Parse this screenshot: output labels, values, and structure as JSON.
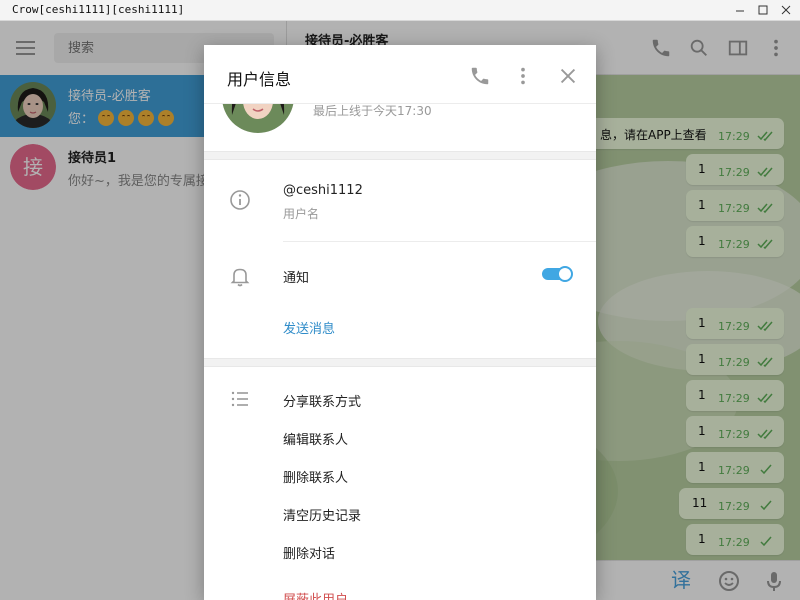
{
  "window": {
    "title": "Crow[ceshi1111][ceshi1111]"
  },
  "sidebar": {
    "search_placeholder": "搜索",
    "chats": [
      {
        "name": "接待员-必胜客",
        "preview_prefix": "您：",
        "active": true
      },
      {
        "name": "接待员1",
        "avatar_letter": "接",
        "preview": "你好~，我是您的专属接待员"
      }
    ]
  },
  "chat": {
    "peer_name": "接待员-必胜客",
    "messages": [
      {
        "text": "息，请在APP上查看",
        "time": "17:29"
      },
      {
        "text": "1",
        "time": "17:29"
      },
      {
        "text": "1",
        "time": "17:29"
      },
      {
        "text": "1",
        "time": "17:29"
      },
      {
        "text": "1",
        "time": "17:29"
      },
      {
        "text": "1",
        "time": "17:29"
      },
      {
        "text": "1",
        "time": "17:29"
      },
      {
        "text": "1",
        "time": "17:29"
      },
      {
        "text": "1",
        "time": "17:29"
      },
      {
        "text": "11",
        "time": "17:29"
      },
      {
        "text": "1",
        "time": "17:29"
      }
    ],
    "composer_translate": "译"
  },
  "modal": {
    "title": "用户信息",
    "last_seen": "最后上线于今天17:30",
    "username": "@ceshi1112",
    "username_label": "用户名",
    "notifications_label": "通知",
    "notifications_on": true,
    "send_message": "发送消息",
    "actions": [
      "分享联系方式",
      "编辑联系人",
      "删除联系人",
      "清空历史记录",
      "删除对话"
    ],
    "block_user": "屏蔽此用户"
  },
  "colors": {
    "accent": "#40a7e3",
    "active_chat": "#419fd9",
    "danger": "#d14e4e",
    "bubble": "#effdde"
  }
}
